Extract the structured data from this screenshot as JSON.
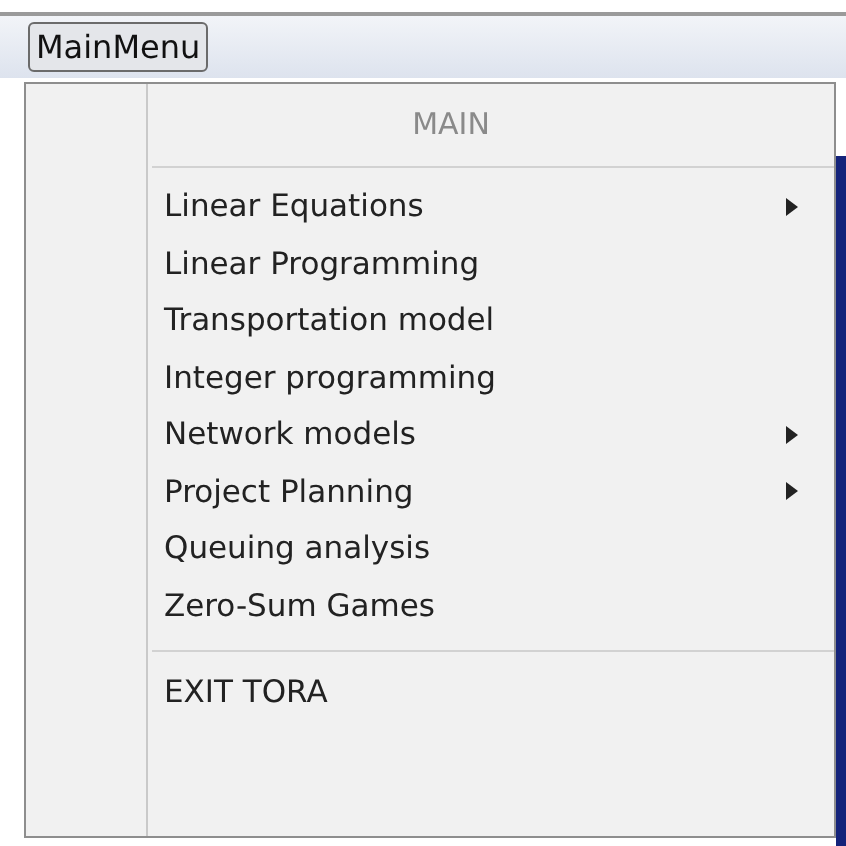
{
  "menu_bar": {
    "button": "MainMenu"
  },
  "menu": {
    "header": "MAIN",
    "items": [
      {
        "label": "Linear Equations",
        "submenu": true
      },
      {
        "label": "Linear Programming",
        "submenu": false
      },
      {
        "label": "Transportation model",
        "submenu": false
      },
      {
        "label": "Integer programming",
        "submenu": false
      },
      {
        "label": "Network models",
        "submenu": true
      },
      {
        "label": "Project Planning",
        "submenu": true
      },
      {
        "label": "Queuing analysis",
        "submenu": false
      },
      {
        "label": "Zero-Sum Games",
        "submenu": false
      }
    ],
    "exit_item": "EXIT TORA"
  }
}
